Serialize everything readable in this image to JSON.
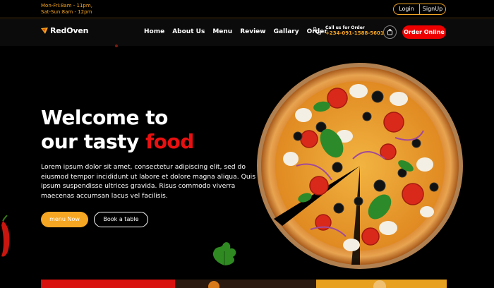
{
  "topbar": {
    "hours_line1": "Mon-Fri:8am - 11pm,",
    "hours_line2": "Sat-Sun:8am - 12pm",
    "login_label": "Login",
    "signup_label": "SignUp"
  },
  "nav": {
    "logo_text": "RedOven",
    "menu": [
      {
        "label": "Home"
      },
      {
        "label": "About Us"
      },
      {
        "label": "Menu"
      },
      {
        "label": "Review"
      },
      {
        "label": "Gallary"
      },
      {
        "label": "Order"
      }
    ],
    "call_label": "Call us for Order",
    "call_number": "+234-091-1588-5601",
    "order_button": "Order Online"
  },
  "hero": {
    "title_line1": "Welcome to",
    "title_line2_prefix": "our tasty ",
    "title_line2_accent": "food",
    "text": "Lorem ipsum dolor sit amet, consectetur adipiscing elit, sed do eiusmod tempor incididunt ut labore et dolore magna aliqua. Quis ipsum suspendisse ultrices gravida. Risus commodo viverra maecenas accumsan lacus vel facilisis.",
    "menu_button": "menu Now",
    "book_button": "Book a table"
  },
  "colors": {
    "accent_orange": "#f5a623",
    "accent_red": "#e81010",
    "background": "#000000"
  },
  "icons": {
    "logo": "oven-flame-icon",
    "call": "phone-icon",
    "cart": "shopping-bag-icon"
  }
}
